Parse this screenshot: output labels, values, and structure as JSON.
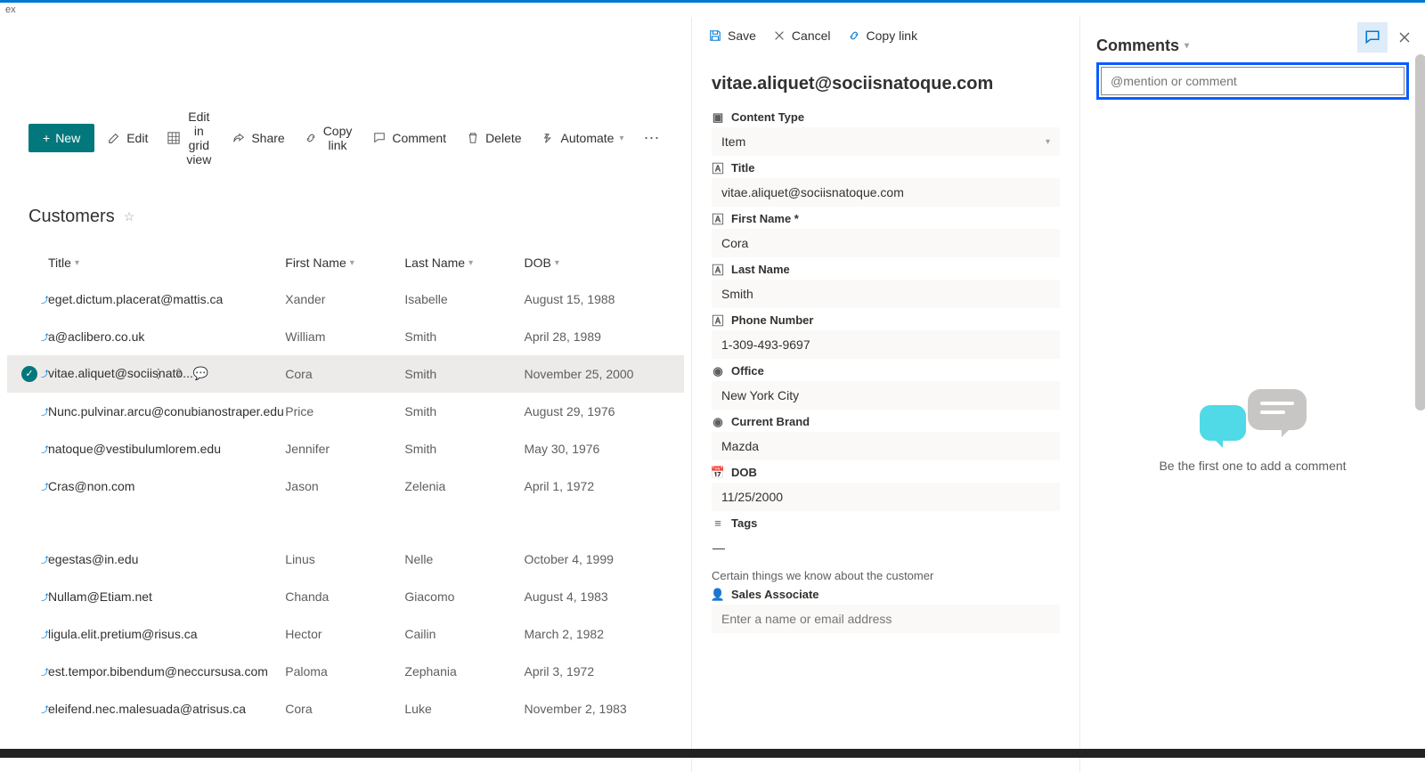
{
  "tabText": "ex",
  "toolbar": {
    "new": "New",
    "edit": "Edit",
    "grid": "Edit in grid view",
    "share": "Share",
    "copylink": "Copy link",
    "comment": "Comment",
    "delete": "Delete",
    "automate": "Automate"
  },
  "list": {
    "title": "Customers",
    "columns": {
      "title": "Title",
      "firstName": "First Name",
      "lastName": "Last Name",
      "dob": "DOB"
    },
    "rows": [
      {
        "title": "eget.dictum.placerat@mattis.ca",
        "fn": "Xander",
        "ln": "Isabelle",
        "dob": "August 15, 1988"
      },
      {
        "title": "a@aclibero.co.uk",
        "fn": "William",
        "ln": "Smith",
        "dob": "April 28, 1989"
      },
      {
        "title": "vitae.aliquet@sociisnato...",
        "fn": "Cora",
        "ln": "Smith",
        "dob": "November 25, 2000",
        "selected": true
      },
      {
        "title": "Nunc.pulvinar.arcu@conubianostraper.edu",
        "fn": "Price",
        "ln": "Smith",
        "dob": "August 29, 1976"
      },
      {
        "title": "natoque@vestibulumlorem.edu",
        "fn": "Jennifer",
        "ln": "Smith",
        "dob": "May 30, 1976"
      },
      {
        "title": "Cras@non.com",
        "fn": "Jason",
        "ln": "Zelenia",
        "dob": "April 1, 1972"
      },
      {
        "title": "egestas@in.edu",
        "fn": "Linus",
        "ln": "Nelle",
        "dob": "October 4, 1999"
      },
      {
        "title": "Nullam@Etiam.net",
        "fn": "Chanda",
        "ln": "Giacomo",
        "dob": "August 4, 1983"
      },
      {
        "title": "ligula.elit.pretium@risus.ca",
        "fn": "Hector",
        "ln": "Cailin",
        "dob": "March 2, 1982"
      },
      {
        "title": "est.tempor.bibendum@neccursusa.com",
        "fn": "Paloma",
        "ln": "Zephania",
        "dob": "April 3, 1972"
      },
      {
        "title": "eleifend.nec.malesuada@atrisus.ca",
        "fn": "Cora",
        "ln": "Luke",
        "dob": "November 2, 1983"
      }
    ]
  },
  "panel": {
    "save": "Save",
    "cancel": "Cancel",
    "copylink": "Copy link",
    "itemTitle": "vitae.aliquet@sociisnatoque.com",
    "fields": {
      "contentType": {
        "label": "Content Type",
        "value": "Item"
      },
      "title": {
        "label": "Title",
        "value": "vitae.aliquet@sociisnatoque.com"
      },
      "firstName": {
        "label": "First Name *",
        "value": "Cora"
      },
      "lastName": {
        "label": "Last Name",
        "value": "Smith"
      },
      "phone": {
        "label": "Phone Number",
        "value": "1-309-493-9697"
      },
      "office": {
        "label": "Office",
        "value": "New York City"
      },
      "brand": {
        "label": "Current Brand",
        "value": "Mazda"
      },
      "dob": {
        "label": "DOB",
        "value": "11/25/2000"
      },
      "tags": {
        "label": "Tags",
        "value": "—"
      },
      "sectionNote": "Certain things we know about the customer",
      "salesAssoc": {
        "label": "Sales Associate",
        "placeholder": "Enter a name or email address"
      }
    }
  },
  "comments": {
    "heading": "Comments",
    "placeholder": "@mention or comment",
    "empty": "Be the first one to add a comment"
  }
}
